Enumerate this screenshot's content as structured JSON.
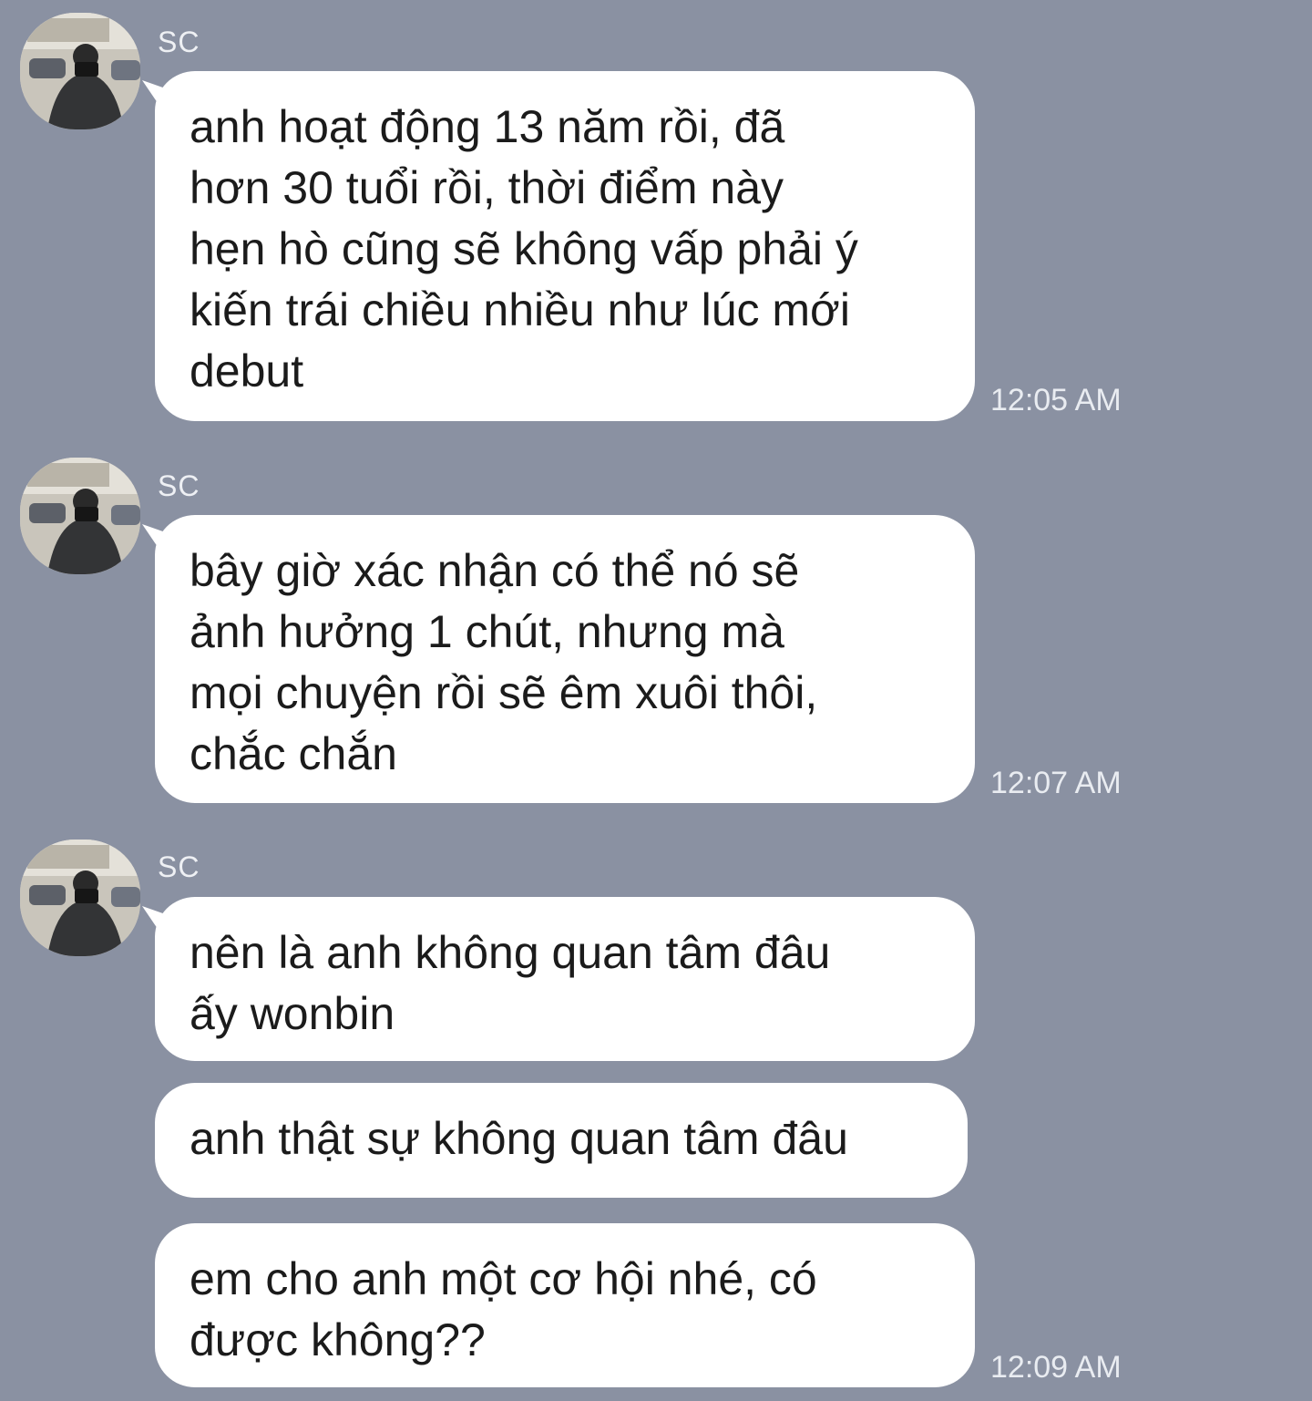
{
  "chat": {
    "groups": [
      {
        "sender": "SC",
        "messages": [
          {
            "text": "anh hoạt động 13 năm rồi, đã\nhơn 30 tuổi rồi, thời điểm này\nhẹn hò cũng sẽ không vấp phải ý\nkiến trái chiều nhiều như lúc mới\ndebut"
          }
        ],
        "time": "12:05 AM"
      },
      {
        "sender": "SC",
        "messages": [
          {
            "text": "bây giờ xác nhận có thể nó sẽ\nảnh hưởng 1 chút, nhưng mà\nmọi chuyện rồi sẽ êm xuôi thôi,\nchắc chắn"
          }
        ],
        "time": "12:07 AM"
      },
      {
        "sender": "SC",
        "messages": [
          {
            "text": "nên là anh không quan tâm đâu\nấy wonbin"
          },
          {
            "text": "anh thật sự không quan tâm đâu"
          },
          {
            "text": "em cho anh một cơ hội nhé, có\nđược không??"
          }
        ],
        "time": "12:09 AM"
      }
    ]
  },
  "colors": {
    "background": "#8a91a2",
    "bubble": "#ffffff",
    "text": "#1b1b1b",
    "meta_text": "#e9ecf1"
  },
  "icons": {
    "avatar": "profile-photo-avatar"
  }
}
